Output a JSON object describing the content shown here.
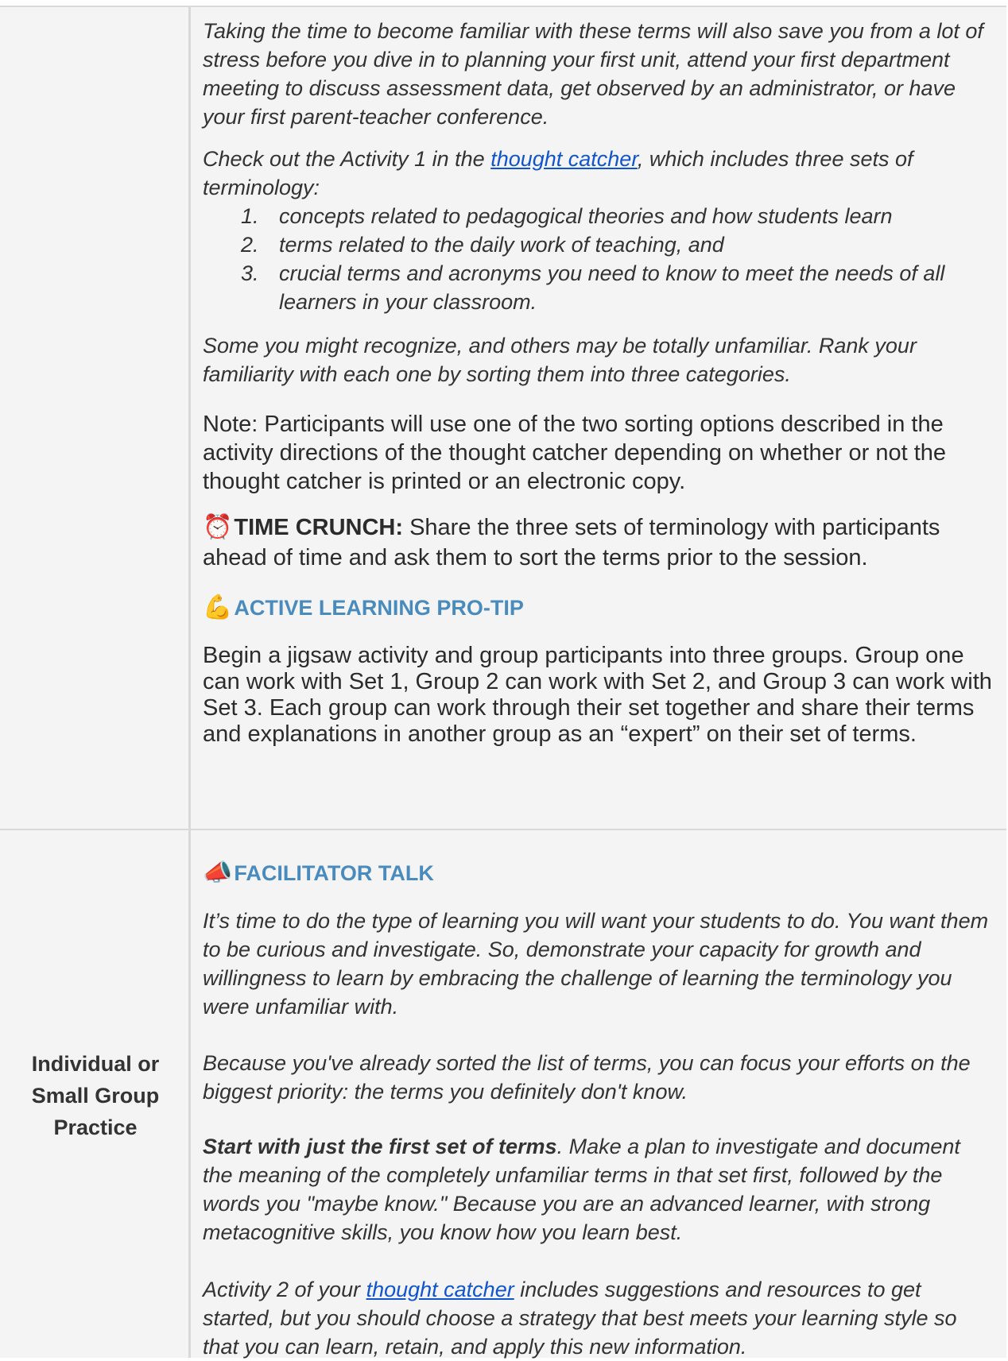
{
  "row1": {
    "para1": "Taking the time to become familiar with these terms will also save you from a lot of stress before you dive in to planning your first unit, attend your first department meeting to discuss assessment data, get observed by an administrator, or have your first parent-teacher conference.",
    "para2_before": "Check out the Activity 1 in the ",
    "para2_link": "thought catcher",
    "para2_after": ", which includes three sets of terminology:",
    "list": [
      {
        "num": "1.",
        "text": "concepts related to pedagogical theories and how students learn"
      },
      {
        "num": "2.",
        "text": "terms related to the daily work of teaching, and"
      },
      {
        "num": "3.",
        "text": "crucial terms and acronyms you need to know to meet the needs of all learners in your classroom."
      }
    ],
    "para3": "Some you might recognize, and others may be totally unfamiliar. Rank your familiarity with each one by sorting them into three categories.",
    "note": "Note: Participants will use one of the two sorting options described in the activity directions of the thought catcher depending on whether or not the thought catcher is printed or an electronic copy.",
    "time_crunch_icon": "alarm-clock-icon",
    "time_crunch_label": "TIME CRUNCH:",
    "time_crunch_text": " Share the three sets of terminology with participants ahead of time and ask them to sort the terms prior to the session.",
    "protip_icon": "flexed-biceps-icon",
    "protip_heading": "ACTIVE LEARNING PRO-TIP",
    "protip_text": "Begin a jigsaw activity and group participants into three groups. Group one can work with Set 1, Group 2 can work with Set 2, and Group 3 can work with Set 3. Each group can work through their set together and share their terms and explanations in another group as an “expert” on their set of terms."
  },
  "row2": {
    "label": "Individual or Small Group Practice",
    "facilitator_icon": "megaphone-icon",
    "facilitator_heading": "FACILITATOR TALK",
    "para1": "It’s time to do the type of learning you will want your students to do. You want them to be curious and investigate. So, demonstrate your capacity for growth and willingness to learn by embracing the challenge of learning the terminology you were unfamiliar with.",
    "para2": "Because you've already sorted the list of terms, you can focus your efforts on the biggest priority: the terms you definitely don't know.",
    "para3_bold": "Start with just the first set of terms",
    "para3_rest": ". Make a plan to investigate and document the meaning of the completely unfamiliar terms in that set first, followed by the words you \"maybe know.\" Because you are an advanced learner, with strong metacognitive skills, you know how you learn best.",
    "para4_before": "Activity 2 of your ",
    "para4_link": "thought catcher",
    "para4_after": " includes suggestions and resources to get started, but you should choose a strategy that best meets your learning style so that you can learn, retain, and apply this new information."
  }
}
